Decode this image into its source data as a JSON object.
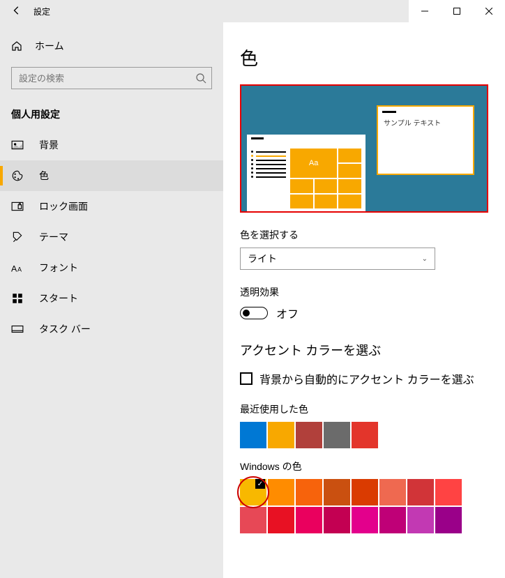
{
  "titlebar": {
    "title": "設定"
  },
  "sidebar": {
    "home": "ホーム",
    "search_placeholder": "設定の検索",
    "section": "個人用設定",
    "items": [
      {
        "label": "背景",
        "icon": "image"
      },
      {
        "label": "色",
        "icon": "palette",
        "active": true
      },
      {
        "label": "ロック画面",
        "icon": "lock"
      },
      {
        "label": "テーマ",
        "icon": "theme"
      },
      {
        "label": "フォント",
        "icon": "font"
      },
      {
        "label": "スタート",
        "icon": "start"
      },
      {
        "label": "タスク バー",
        "icon": "taskbar"
      }
    ]
  },
  "page": {
    "title": "色",
    "preview_sample_text": "サンプル テキスト",
    "preview_aa": "Aa",
    "choose_color_label": "色を選択する",
    "choose_color_value": "ライト",
    "transparency_label": "透明効果",
    "transparency_value": "オフ",
    "accent_heading": "アクセント カラーを選ぶ",
    "auto_accent_label": "背景から自動的にアクセント カラーを選ぶ",
    "recent_colors_label": "最近使用した色",
    "recent_colors": [
      "#0078d4",
      "#f8a800",
      "#b1403b",
      "#6b6b6b",
      "#e3352b"
    ],
    "windows_colors_label": "Windows の色",
    "windows_colors_row1": [
      "#f8b800",
      "#ff8c00",
      "#f7630c",
      "#ca5010",
      "#da3b01",
      "#ef6950",
      "#d13438",
      "#ff4343"
    ],
    "windows_colors_row2": [
      "#e74856",
      "#e81123",
      "#ea005e",
      "#c30052",
      "#e3008c",
      "#bf0077",
      "#c239b3",
      "#9a0089"
    ],
    "selected_index": 0
  }
}
